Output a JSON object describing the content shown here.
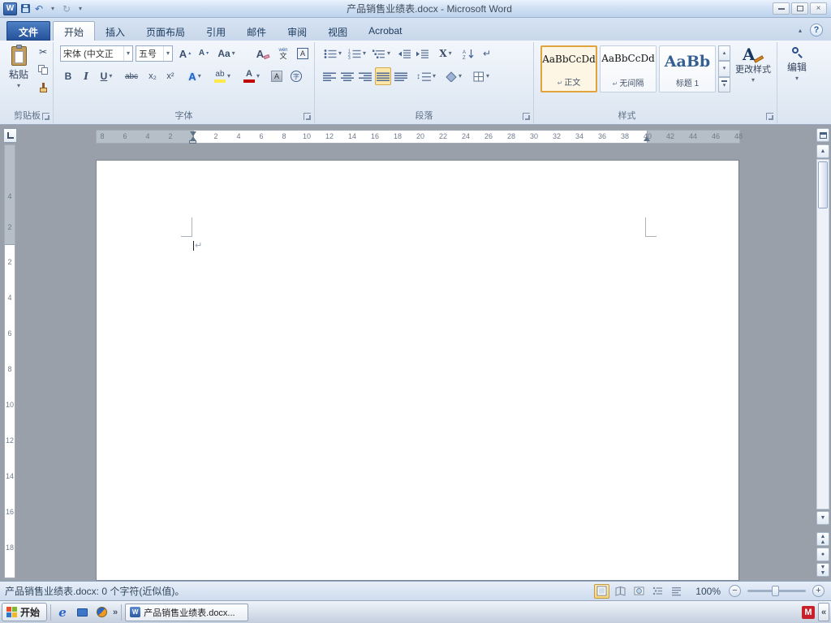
{
  "window": {
    "title": "产品销售业绩表.docx - Microsoft Word"
  },
  "tabs": [
    "文件",
    "开始",
    "插入",
    "页面布局",
    "引用",
    "邮件",
    "审阅",
    "视图",
    "Acrobat"
  ],
  "ribbon": {
    "clipboard": {
      "label": "剪贴板",
      "paste": "粘贴"
    },
    "font": {
      "label": "字体",
      "name": "宋体 (中文正",
      "size": "五号"
    },
    "paragraph": {
      "label": "段落"
    },
    "styles": {
      "label": "样式",
      "change": "更改样式",
      "items": [
        {
          "preview": "AaBbCcDd",
          "name": "正文"
        },
        {
          "preview": "AaBbCcDd",
          "name": "无间隔"
        },
        {
          "preview": "AaBb",
          "name": "标题 1"
        }
      ]
    },
    "editing": {
      "label": "编辑"
    }
  },
  "ruler": {
    "h": [
      "8",
      "6",
      "4",
      "2",
      "",
      "2",
      "4",
      "6",
      "8",
      "10",
      "12",
      "14",
      "16",
      "18",
      "20",
      "22",
      "24",
      "26",
      "28",
      "30",
      "32",
      "34",
      "36",
      "38",
      "40",
      "42",
      "44",
      "46",
      "48"
    ],
    "v_top": [
      "4",
      "2"
    ],
    "v_main": [
      "2",
      "4",
      "6",
      "8",
      "10",
      "12",
      "14",
      "16",
      "18"
    ]
  },
  "statusbar": {
    "text": "产品销售业绩表.docx: 0 个字符(近似值)。",
    "zoom": "100%"
  },
  "taskbar": {
    "start": "开始",
    "doc": "产品销售业绩表.docx..."
  },
  "glyphs": {
    "w": "W",
    "caret": "▾",
    "caret_up": "▴",
    "undo": "↶",
    "repeat": "↻",
    "close": "×",
    "help": "?",
    "cut": "✂",
    "bold": "B",
    "italic": "I",
    "underline": "U",
    "strike": "abc",
    "subscript": "x₂",
    "superscript": "x²",
    "grow": "A",
    "shrink": "A",
    "change_case": "Aa",
    "clear_format": "A",
    "pinyin_top": "wén",
    "pinyin_bottom": "文",
    "char_border": "A",
    "text_effects": "A",
    "highlight": "ab",
    "font_color": "A",
    "char_shading": "A",
    "enclose": "字",
    "asian_layout": "X",
    "sort_a": "A",
    "sort_z": "Z",
    "show_hide": "↵",
    "updown": "↕",
    "one": "1",
    "two": "2",
    "three": "3",
    "scroll_up": "▲",
    "scroll_down": "▼",
    "minus": "−",
    "plus": "+",
    "browse_dot": "●",
    "tray_chev": "«",
    "overflow_chev": "»",
    "m": "M",
    "e": "e",
    "pilcrow": "↵"
  }
}
